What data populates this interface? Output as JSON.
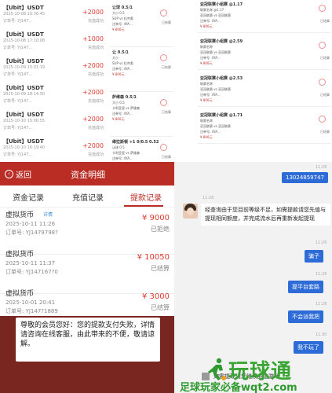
{
  "deposits": [
    {
      "title": "【Ubit】USDT",
      "time": "2025-10-08 10:36:45",
      "order": "订单号: YJ147…",
      "amount": "+2000",
      "status": "充值成功"
    },
    {
      "title": "【Ubit】USDT",
      "time": "2025-10-08 17:10:08",
      "order": "订单号: YJ147…",
      "amount": "+1000",
      "status": "充值成功"
    },
    {
      "title": "【Ubit】USDT",
      "time": "2025-10-09 15:01:19",
      "order": "订单号: YJ147…",
      "amount": "+2000",
      "status": "充值成功"
    },
    {
      "title": "【Ubit】USDT",
      "time": "2025-10-09 18:14:50",
      "order": "订单号: YJ147…",
      "amount": "+2000",
      "status": "充值成功"
    },
    {
      "title": "【Ubit】USDT",
      "time": "2025-10-10 15:00:55",
      "order": "订单号: YJ147…",
      "amount": "+2000",
      "status": "充值成功"
    },
    {
      "title": "【Ubit】USDT",
      "time": "2025-10-10 16:19:40",
      "order": "订单号: YJ147…",
      "amount": "+2000",
      "status": "充值成功"
    }
  ],
  "bets_mid": [
    {
      "title": "让球 0.5/1",
      "line1": "大小 0.5",
      "line2": "SUP vs 拉齐奥",
      "line3": "注单号: 4YA…",
      "amount": "¥ 800元",
      "status": "已结算"
    },
    {
      "title": "让 0.5/1",
      "line1": "大小",
      "line2": "SUP vs 拉齐奥",
      "line3": "注单号: 4YA…",
      "amount": "¥ 800元",
      "status": "已结算"
    },
    {
      "title": "萨维森 0.5/1",
      "line1": "大小 0.5",
      "line2": "卡利亚里 vs 萨维森",
      "line3": "注单号: 4YA…",
      "amount": "¥ 800元",
      "status": "已结算"
    },
    {
      "title": "维拉斯顿 +1 0/0.5 0.52",
      "line1": "让球 0.5",
      "line2": "卡利亚里 vs 萨维森",
      "line3": "注单号: 4YA…",
      "amount": "¥ 800元",
      "status": "已结算"
    }
  ],
  "bets_right": [
    {
      "title": "亚冠联赛小组赛 @1.17",
      "line1": "联赛名称 @1.17",
      "line2": "亚冠联赛 vs 亚冠联赛",
      "line3": "注单号: 4YA…",
      "amount": "¥ 800元",
      "status": "已结算"
    },
    {
      "title": "亚冠联赛小组赛 @2.59",
      "line1": "联赛名称",
      "line2": "亚冠联赛 vs 亚冠联赛",
      "line3": "注单号: 4YA…",
      "amount": "¥ 800元",
      "status": "已结算"
    },
    {
      "title": "亚冠联赛小组赛 @2.53",
      "line1": "联赛名称",
      "line2": "亚冠联赛 vs 亚冠联赛",
      "line3": "注单号: 4YA…",
      "amount": "¥ 800元",
      "status": "已结算"
    },
    {
      "title": "亚冠联赛小组赛 @1.71",
      "line1": "联赛名称",
      "line2": "亚冠联赛 vs 亚冠联赛",
      "line3": "注单号: 4YA…",
      "amount": "¥ 800元",
      "status": "已结算"
    }
  ],
  "fund": {
    "back_label": "返回",
    "title": "资金明细",
    "tabs": [
      "资金记录",
      "充值记录",
      "提款记录"
    ],
    "active_tab": 2,
    "records": [
      {
        "title": "虚拟货币",
        "tag": "详情",
        "time": "2025-10-11 11:26",
        "order": "订单号: YJ1479798?",
        "amount": "¥ 9000",
        "status": "已拒绝"
      },
      {
        "title": "虚拟货币",
        "tag": "",
        "time": "2025-10-11 11:37",
        "order": "订单号: YJ147167?0",
        "amount": "¥ 10050",
        "status": "已结算"
      },
      {
        "title": "虚拟货币",
        "tag": "",
        "time": "2025-10-01 20:41",
        "order": "订单号: YJ147?1889",
        "amount": "¥ 3000",
        "status": "已结算"
      }
    ],
    "notice": "尊敬的会员您好：您的提款支付失败，详情请咨询在线客服，由此带来的不便，敬请谅解。",
    "colors": {
      "header": "#b92d25",
      "amount": "#e03a2f"
    }
  },
  "chat": {
    "messages": [
      {
        "side": "right",
        "time": "11:26",
        "text": "13024859747"
      },
      {
        "side": "left",
        "time": "11:26",
        "text": "经查询由于您目前等级不足，如需提款请您先值与提现相同额度，并完成流水后再重新发起提现"
      },
      {
        "side": "right",
        "time": "11:26",
        "text": "骗子"
      },
      {
        "side": "right",
        "time": "11:26",
        "text": "提平台套路"
      },
      {
        "side": "right",
        "time": "11:28",
        "text": "不会派我把"
      },
      {
        "side": "right",
        "time": "11:30",
        "text": "我不玩了"
      }
    ],
    "bottom_text": "如需提现请您继续充值游戏"
  },
  "watermark": {
    "big": "玩球通",
    "small": "足球玩家必备wqt2.com",
    "color": "#3aa535"
  }
}
